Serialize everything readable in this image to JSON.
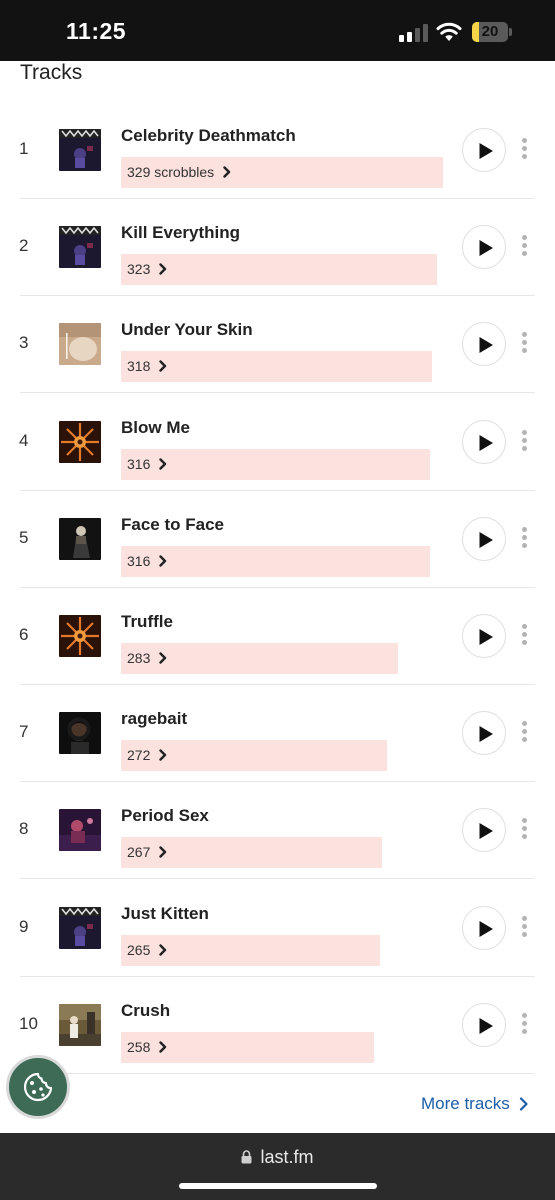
{
  "status_bar": {
    "time": "11:25",
    "battery": "20"
  },
  "section": {
    "title": "Tracks"
  },
  "tracks": [
    {
      "rank": "1",
      "name": "Celebrity Deathmatch",
      "count": "329 scrobbles",
      "scrobbles": 329,
      "art": "dark-blue-figure"
    },
    {
      "rank": "2",
      "name": "Kill Everything",
      "count": "323",
      "scrobbles": 323,
      "art": "dark-blue-figure"
    },
    {
      "rank": "3",
      "name": "Under Your Skin",
      "count": "318",
      "scrobbles": 318,
      "art": "beige-skin"
    },
    {
      "rank": "4",
      "name": "Blow Me",
      "count": "316",
      "scrobbles": 316,
      "art": "orange-burst"
    },
    {
      "rank": "5",
      "name": "Face to Face",
      "count": "316",
      "scrobbles": 316,
      "art": "night-figure"
    },
    {
      "rank": "6",
      "name": "Truffle",
      "count": "283",
      "scrobbles": 283,
      "art": "orange-burst"
    },
    {
      "rank": "7",
      "name": "ragebait",
      "count": "272",
      "scrobbles": 272,
      "art": "dark-portrait"
    },
    {
      "rank": "8",
      "name": "Period Sex",
      "count": "267",
      "scrobbles": 267,
      "art": "purple-room"
    },
    {
      "rank": "9",
      "name": "Just Kitten",
      "count": "265",
      "scrobbles": 265,
      "art": "dark-blue-figure"
    },
    {
      "rank": "10",
      "name": "Crush",
      "count": "258",
      "scrobbles": 258,
      "art": "outdoor-figure"
    }
  ],
  "more_tracks_label": "More tracks",
  "browser": {
    "url": "last.fm"
  },
  "colors": {
    "bar": "#fbe2df",
    "link": "#1c5ea8",
    "cookie": "#3d6b56"
  },
  "icons": {
    "play": "play-icon",
    "more": "more-vertical-icon",
    "chevron": "chevron-right-icon",
    "cookie": "cookie-icon",
    "lock": "lock-icon"
  }
}
